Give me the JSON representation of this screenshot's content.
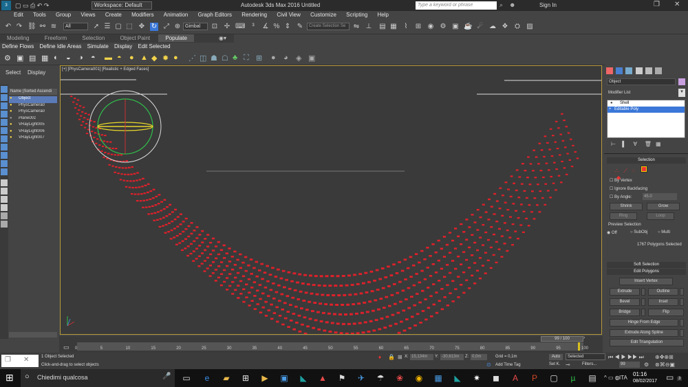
{
  "window": {
    "title": "Autodesk 3ds Max 2016    Untitled",
    "workspace": "Workspace: Default",
    "search_placeholder": "Type a keyword or phrase",
    "sign_in": "Sign In"
  },
  "menu": [
    "Edit",
    "Tools",
    "Group",
    "Views",
    "Create",
    "Modifiers",
    "Animation",
    "Graph Editors",
    "Rendering",
    "Civil View",
    "Customize",
    "Scripting",
    "Help"
  ],
  "toolbar": {
    "selection_filter": "All",
    "ref_coord": "Gimbal",
    "named_selection": "Create Selection Se"
  },
  "ribbon": {
    "tabs": [
      "Modeling",
      "Freeform",
      "Selection",
      "Object Paint",
      "Populate"
    ],
    "active_tab": "Populate",
    "tools": [
      "Define Flows",
      "Define Idle Areas",
      "Simulate",
      "Display",
      "Edit Selected"
    ]
  },
  "scene_explorer": {
    "tabs": [
      "Select",
      "Display"
    ],
    "header": "Name (Sorted Ascendi",
    "items": [
      "Object",
      "PhysCamera0",
      "PhysCamera0",
      "Plane001",
      "VRayLight005",
      "VRayLight006",
      "VRayLight007"
    ]
  },
  "viewport": {
    "label": "[+] [PhysCamera001] [Realistic + Edged Faces]"
  },
  "command_panel": {
    "object_name": "Object",
    "modifier_list": "Modifier List",
    "stack": [
      "Shell",
      "Editable Poly"
    ],
    "selected_modifier": "Editable Poly",
    "selection_title": "Selection",
    "by_vertex": "By Vertex",
    "ignore_backfacing": "Ignore Backfacing",
    "by_angle": "By Angle:",
    "by_angle_value": "45.0",
    "shrink": "Shrink",
    "grow": "Grow",
    "ring": "Ring",
    "loop": "Loop",
    "preview_selection": "Preview Selection",
    "preview_off": "Off",
    "preview_subobj": "SubObj",
    "preview_multi": "Multi",
    "selected_count": "1767 Polygons Selected",
    "soft_selection": "Soft Selection",
    "edit_polygons": "Edit Polygons",
    "insert_vertex": "Insert Vertex",
    "extrude": "Extrude",
    "outline": "Outline",
    "bevel": "Bevel",
    "inset": "Inset",
    "bridge": "Bridge",
    "flip": "Flip",
    "hinge_from_edge": "Hinge From Edge",
    "extrude_along_spline": "Extrude Along Spline",
    "edit_triangulation": "Edit Triangulation"
  },
  "timeline": {
    "frame_display": "99 / 100",
    "current_frame": 99,
    "total_frames": 100,
    "ticks": [
      "0",
      "5",
      "10",
      "15",
      "20",
      "25",
      "30",
      "35",
      "40",
      "45",
      "50",
      "55",
      "60",
      "65",
      "70",
      "75",
      "80",
      "85",
      "90",
      "95",
      "100"
    ]
  },
  "status": {
    "objects_selected": "1 Object Selected",
    "prompt": "Click-and-drag to select objects",
    "x_label": "X:",
    "x_value": "15,134m",
    "y_label": "Y:",
    "y_value": "-30,613m",
    "z_label": "Z:",
    "z_value": "0,0m",
    "grid": "Grid = 0,1m",
    "auto": "Auto",
    "selected": "Selected",
    "add_time_tag": "Add Time Tag",
    "set_k": "Set K.",
    "filters": "Filters...",
    "frame_field": "99"
  },
  "taskbar": {
    "search": "Chiedimi qualcosa",
    "language": "ITA",
    "time": "01:16",
    "date": "08/02/2017",
    "notifications": "3"
  },
  "colors": {
    "accent_blue": "#3a77d8",
    "poly_red": "#e0202a",
    "viewport_border": "#b89b3a"
  }
}
